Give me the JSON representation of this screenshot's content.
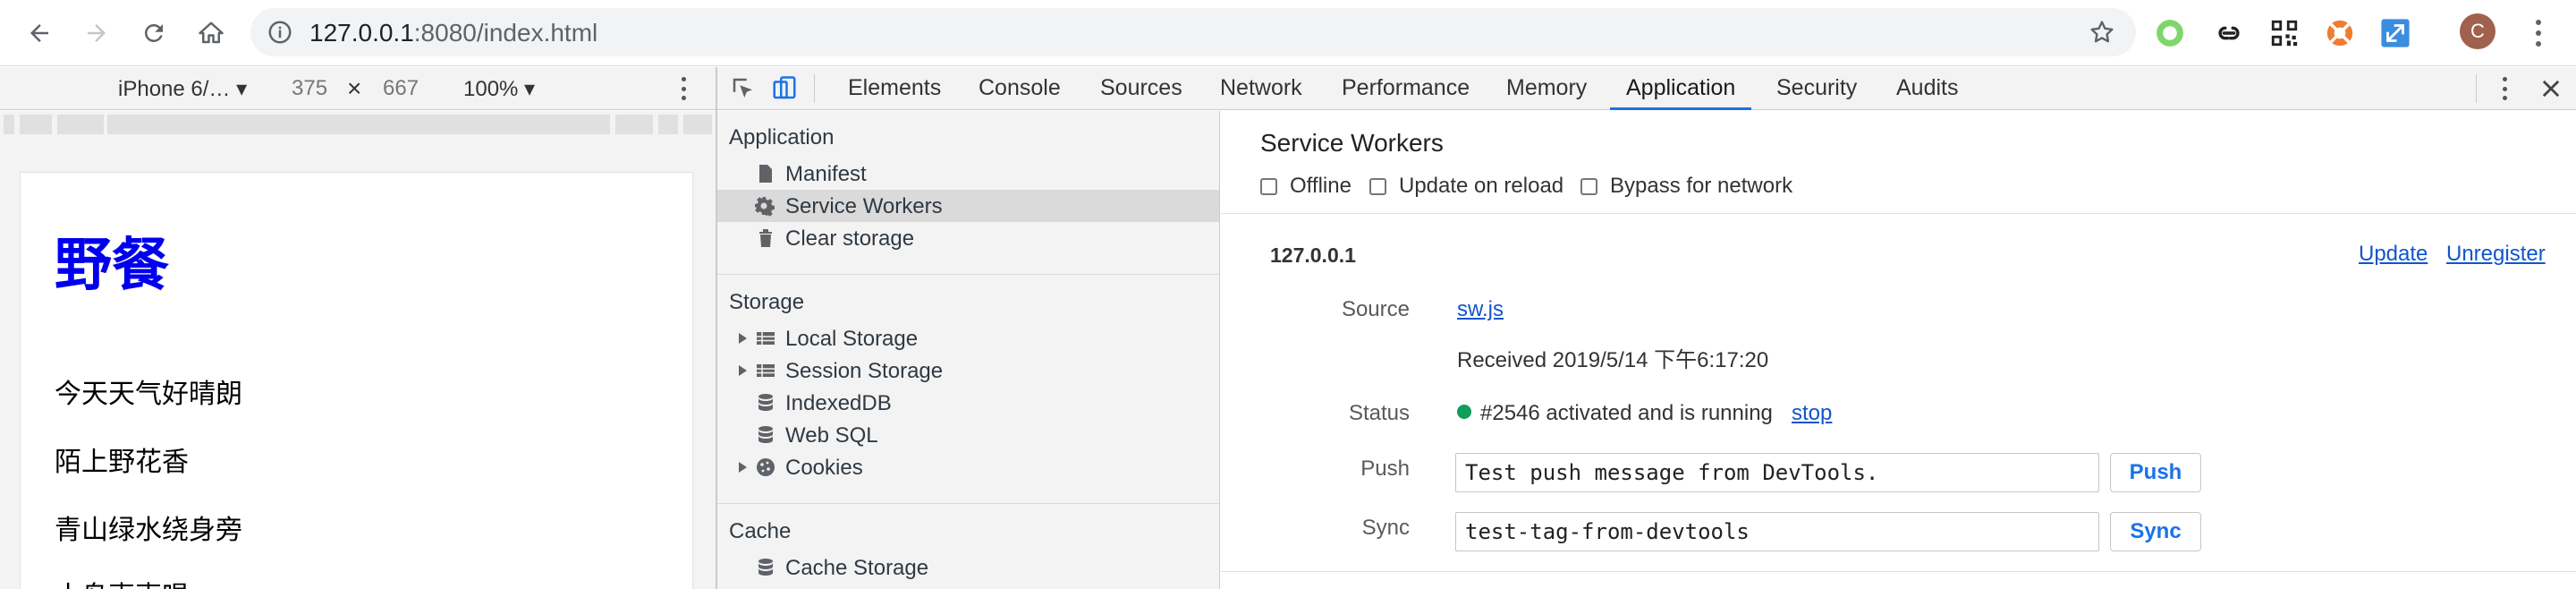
{
  "browser": {
    "url_host": "127.0.0.1",
    "url_rest": ":8080/index.html",
    "avatar_letter": "C",
    "icons": [
      "back-icon",
      "forward-icon",
      "reload-icon",
      "home-icon",
      "info-icon",
      "star-icon",
      "menu-icon"
    ]
  },
  "device_toolbar": {
    "device": "iPhone 6/… ▾",
    "width": "375",
    "times": "×",
    "height": "667",
    "zoom": "100% ▾"
  },
  "page": {
    "heading": "野餐",
    "lines": [
      "今天天气好晴朗",
      "陌上野花香",
      "青山绿水绕身旁",
      "小鸟声声唱"
    ]
  },
  "devtools": {
    "tabs": [
      "Elements",
      "Console",
      "Sources",
      "Network",
      "Performance",
      "Memory",
      "Application",
      "Security",
      "Audits"
    ],
    "active_tab": "Application",
    "accent": "#1a73e8"
  },
  "sidebar": {
    "application_title": "Application",
    "application_items": [
      "Manifest",
      "Service Workers",
      "Clear storage"
    ],
    "selected_item": "Service Workers",
    "storage_title": "Storage",
    "storage_items": [
      "Local Storage",
      "Session Storage",
      "IndexedDB",
      "Web SQL",
      "Cookies"
    ],
    "cache_title": "Cache",
    "cache_items": [
      "Cache Storage"
    ]
  },
  "service_workers": {
    "title": "Service Workers",
    "options": [
      "Offline",
      "Update on reload",
      "Bypass for network"
    ],
    "origin": "127.0.0.1",
    "update_label": "Update",
    "unregister_label": "Unregister",
    "source_key": "Source",
    "source_file": "sw.js",
    "received": "Received 2019/5/14 下午6:17:20",
    "status_key": "Status",
    "status_text": "#2546 activated and is running",
    "status_color": "#0f9d58",
    "stop_label": "stop",
    "push_key": "Push",
    "push_value": "Test push message from DevTools.",
    "push_button": "Push",
    "sync_key": "Sync",
    "sync_value": "test-tag-from-devtools",
    "sync_button": "Sync"
  }
}
